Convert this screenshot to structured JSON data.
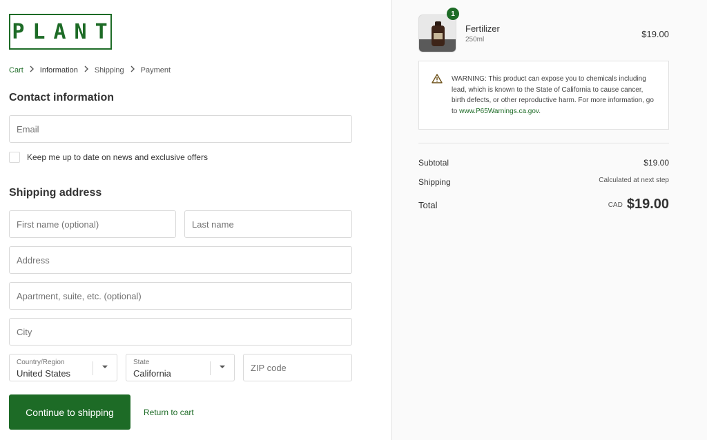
{
  "brand": {
    "logo_text": "PLANT"
  },
  "breadcrumb": {
    "cart": "Cart",
    "information": "Information",
    "shipping": "Shipping",
    "payment": "Payment"
  },
  "contact": {
    "title": "Contact information",
    "email_placeholder": "Email",
    "newsletter_label": "Keep me up to date on news and exclusive offers"
  },
  "shipping": {
    "title": "Shipping address",
    "first_name_placeholder": "First name (optional)",
    "last_name_placeholder": "Last name",
    "address_placeholder": "Address",
    "apartment_placeholder": "Apartment, suite, etc. (optional)",
    "city_placeholder": "City",
    "country_label": "Country/Region",
    "country_value": "United States",
    "state_label": "State",
    "state_value": "California",
    "zip_placeholder": "ZIP code"
  },
  "actions": {
    "continue_label": "Continue to shipping",
    "return_label": "Return to cart"
  },
  "order": {
    "item": {
      "name": "Fertilizer",
      "variant": "250ml",
      "price": "$19.00",
      "quantity": "1"
    },
    "warning": {
      "text": "WARNING: This product can expose you to chemicals including lead, which is known to the State of California to cause cancer, birth defects, or other reproductive harm. For more information, go to ",
      "link": "www.P65Warnings.ca.gov",
      "suffix": "."
    },
    "subtotal_label": "Subtotal",
    "subtotal_value": "$19.00",
    "shipping_label": "Shipping",
    "shipping_value": "Calculated at next step",
    "total_label": "Total",
    "total_currency": "CAD",
    "total_value": "$19.00"
  },
  "colors": {
    "brand_green": "#1d6b26",
    "border": "#d9d9d9",
    "sidebar_bg": "#fafafa"
  },
  "icons": {
    "warning": "warning-triangle-icon",
    "select_arrow": "chevron-down-icon",
    "breadcrumb_separator": "chevron-right-icon"
  }
}
